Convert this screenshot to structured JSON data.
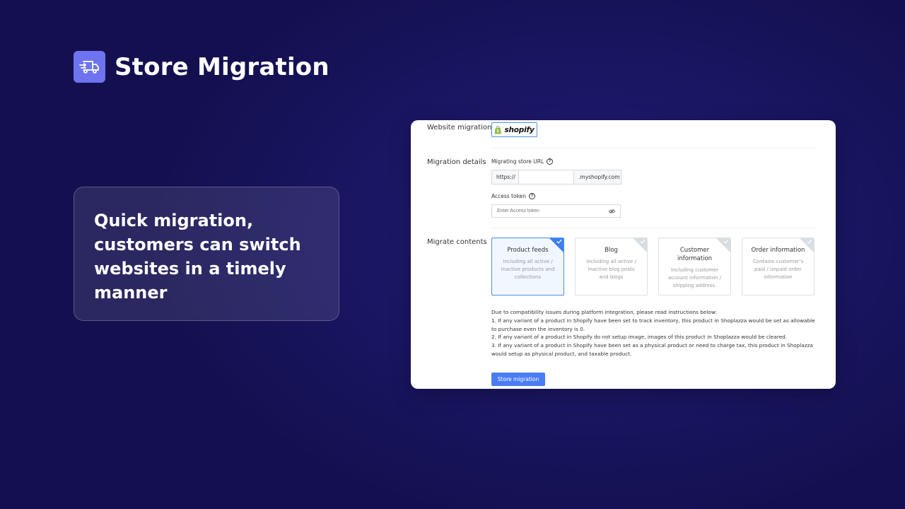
{
  "brand": {
    "title": "Store Migration",
    "icon": "delivery-truck-icon",
    "icon_bg": "#6e74f0"
  },
  "tagline": "Quick migration, customers can switch websites in a timely manner",
  "panel": {
    "website_migration": {
      "label": "Website migration",
      "platform": "shopify"
    },
    "migration_details": {
      "label": "Migration details",
      "store_url_label": "Migrating store URL",
      "url_prefix": "https://",
      "url_value": "",
      "url_suffix": ".myshopify.com",
      "access_token_label": "Access token",
      "access_token_placeholder": "Enter Access token"
    },
    "migrate_contents": {
      "label": "Migrate contents",
      "cards": [
        {
          "title": "Product feeds",
          "desc": "Including all active / inactive products and collections",
          "selected": true
        },
        {
          "title": "Blog",
          "desc": "Including all active / inactive blog posts and blogs",
          "selected": false
        },
        {
          "title": "Customer information",
          "desc": "Including customer account information / shipping address.",
          "selected": false
        },
        {
          "title": "Order information",
          "desc": "Contains customer's paid / unpaid order information",
          "selected": false
        }
      ]
    },
    "notes": [
      "Due to compatibility issues during platform integration, please read instructions below:",
      "1. If any variant of a product in Shopify have been set to track inventory, this product in Shoplazza would be set as allowable to purchase even the inventory is 0.",
      "2. If any variant of a product in Shopify do not setup image, images of this product in Shoplazza would be cleared.",
      "3. If any variant of a product in Shopify have been set as a physical product or need to charge tax, this product in Shoplazza would setup as physical product, and taxable product."
    ],
    "submit_label": "Store migration",
    "accent": "#4a7df3"
  }
}
